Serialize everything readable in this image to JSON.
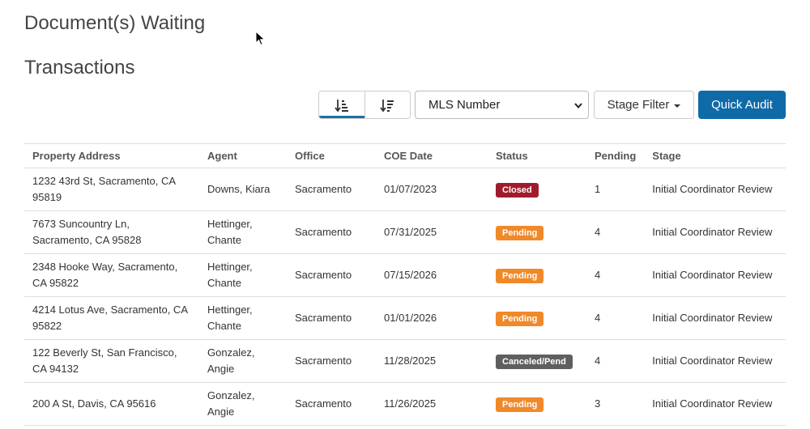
{
  "page_title": "Document(s) Waiting",
  "section_title": "Transactions",
  "toolbar": {
    "sort_ascending_icon": "sort-ascending-icon",
    "sort_descending_icon": "sort-descending-icon",
    "select_value": "MLS Number",
    "stage_filter_label": "Stage Filter",
    "quick_audit_label": "Quick Audit"
  },
  "table": {
    "headers": [
      "Property Address",
      "Agent",
      "Office",
      "COE Date",
      "Status",
      "Pending",
      "Stage"
    ],
    "rows": [
      {
        "address": "1232 43rd St, Sacramento, CA 95819",
        "agent": "Downs, Kiara",
        "office": "Sacramento",
        "coe": "01/07/2023",
        "status": "Closed",
        "status_color": "#a01c2c",
        "pending": "1",
        "stage": "Initial Coordinator Review"
      },
      {
        "address": "7673 Suncountry Ln, Sacramento, CA 95828",
        "agent": "Hettinger, Chante",
        "office": "Sacramento",
        "coe": "07/31/2025",
        "status": "Pending",
        "status_color": "#f0892a",
        "pending": "4",
        "stage": "Initial Coordinator Review"
      },
      {
        "address": "2348 Hooke Way, Sacramento, CA 95822",
        "agent": "Hettinger, Chante",
        "office": "Sacramento",
        "coe": "07/15/2026",
        "status": "Pending",
        "status_color": "#f0892a",
        "pending": "4",
        "stage": "Initial Coordinator Review"
      },
      {
        "address": "4214 Lotus Ave, Sacramento, CA 95822",
        "agent": "Hettinger, Chante",
        "office": "Sacramento",
        "coe": "01/01/2026",
        "status": "Pending",
        "status_color": "#f0892a",
        "pending": "4",
        "stage": "Initial Coordinator Review"
      },
      {
        "address": "122 Beverly St, San Francisco, CA 94132",
        "agent": "Gonzalez, Angie",
        "office": "Sacramento",
        "coe": "11/28/2025",
        "status": "Canceled/Pend",
        "status_color": "#5f5f5f",
        "pending": "4",
        "stage": "Initial Coordinator Review"
      },
      {
        "address": "200 A St, Davis, CA 95616",
        "agent": "Gonzalez, Angie",
        "office": "Sacramento",
        "coe": "11/26/2025",
        "status": "Pending",
        "status_color": "#f0892a",
        "pending": "3",
        "stage": "Initial Coordinator Review"
      }
    ]
  },
  "colors": {
    "accent": "#0f6aa8",
    "status_closed": "#a01c2c",
    "status_pending": "#f0892a",
    "status_canceled": "#5f5f5f"
  }
}
